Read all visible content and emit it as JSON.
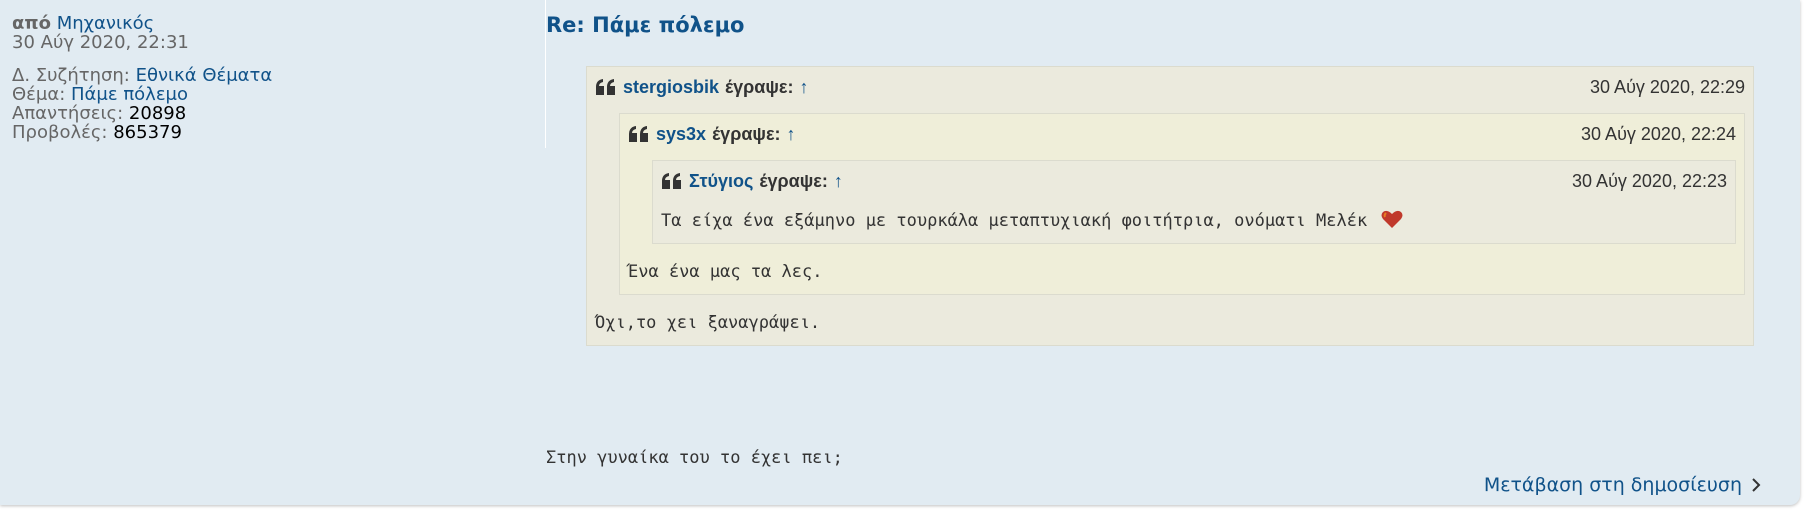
{
  "profile": {
    "by_label": "από",
    "author": "Μηχανικός",
    "date": "30 Αύγ 2020, 22:31",
    "forum_label": "Δ. Συζήτηση:",
    "forum": "Εθνικά Θέματα",
    "topic_label": "Θέμα:",
    "topic": "Πάμε πόλεμο",
    "replies_label": "Απαντήσεις:",
    "replies": "20898",
    "views_label": "Προβολές:",
    "views": "865379"
  },
  "post": {
    "title": "Re: Πάμε πόλεμο",
    "text": "Στην γυναίκα του το έχει πει;",
    "jump_label": "Μετάβαση στη δημοσίευση"
  },
  "quotes": [
    {
      "author": "stergiosbik",
      "wrote": "έγραψε:",
      "arrow": "↑",
      "date": "30 Αύγ 2020, 22:29",
      "text": "Όχι,το χει ξαναγράψει."
    },
    {
      "author": "sys3x",
      "wrote": "έγραψε:",
      "arrow": "↑",
      "date": "30 Αύγ 2020, 22:24",
      "text": "Ένα ένα μας τα λες."
    },
    {
      "author": "Στύγιος",
      "wrote": "έγραψε:",
      "arrow": "↑",
      "date": "30 Αύγ 2020, 22:23",
      "text": "Τα είχα ένα εξάμηνο με τουρκάλα μεταπτυχιακή φοιτήτρια, ονόματι Μελέκ"
    }
  ],
  "colors": {
    "link": "#105289",
    "panel": "#e1ebf2",
    "quote_bg": "#ebeadd",
    "quote_bg_alt": "#efeed9"
  }
}
